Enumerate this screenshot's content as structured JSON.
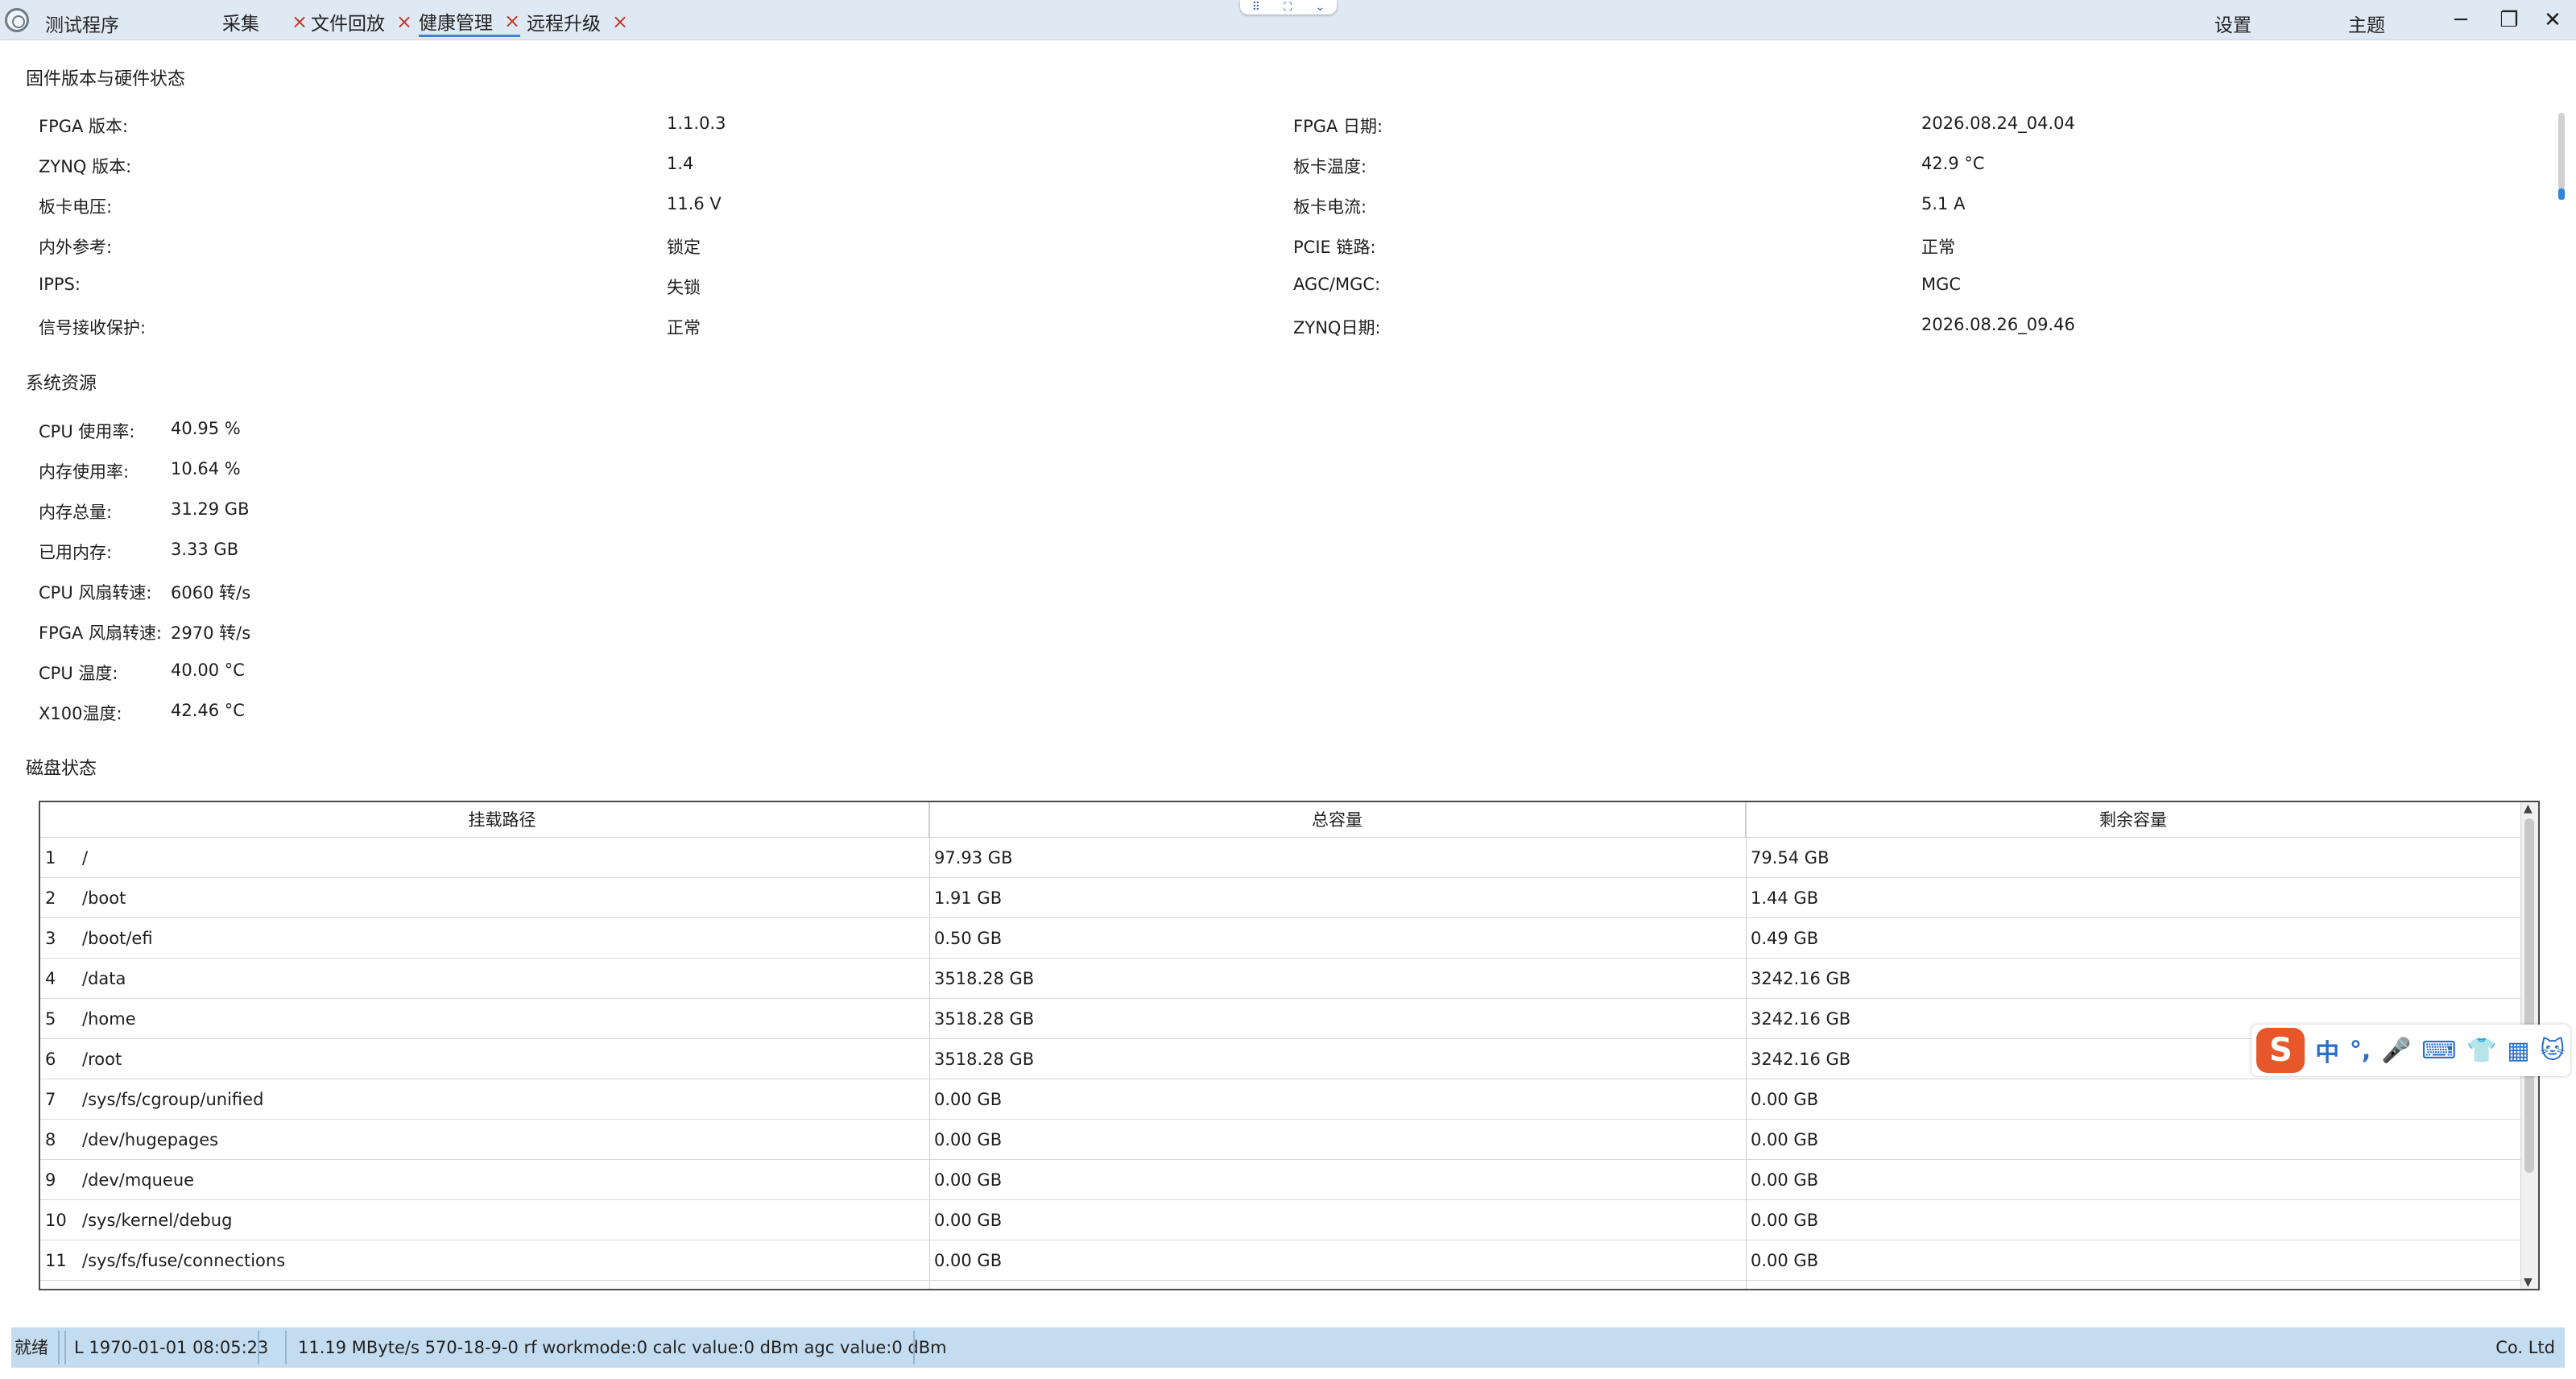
{
  "app": {
    "title": "测试程序"
  },
  "tabs": [
    {
      "label": "采集",
      "close": "×"
    },
    {
      "label": "文件回放",
      "close": "×"
    },
    {
      "label": "健康管理",
      "close": "×",
      "active": true
    },
    {
      "label": "远程升级",
      "close": "×"
    }
  ],
  "menu": {
    "settings": "设置",
    "theme": "主题"
  },
  "window_controls": {
    "minimize": "─",
    "maximize": "❐",
    "close": "✕"
  },
  "firmware": {
    "title": "固件版本与硬件状态",
    "items": [
      {
        "label": "FPGA 版本:",
        "value": "1.1.0.3"
      },
      {
        "label": "FPGA 日期:",
        "value": "2026.08.24_04.04"
      },
      {
        "label": "ZYNQ 版本:",
        "value": "1.4"
      },
      {
        "label": "板卡温度:",
        "value": "42.9 °C"
      },
      {
        "label": "板卡电压:",
        "value": "11.6 V"
      },
      {
        "label": "板卡电流:",
        "value": "5.1 A"
      },
      {
        "label": "内外参考:",
        "value": "锁定"
      },
      {
        "label": "PCIE 链路:",
        "value": "正常"
      },
      {
        "label": "IPPS:",
        "value": "失锁"
      },
      {
        "label": "AGC/MGC:",
        "value": "MGC"
      },
      {
        "label": "信号接收保护:",
        "value": "正常"
      },
      {
        "label": "ZYNQ日期:",
        "value": "2026.08.26_09.46"
      }
    ]
  },
  "resources": {
    "title": "系统资源",
    "items": [
      {
        "label": "CPU 使用率:",
        "value": "40.95 %"
      },
      {
        "label": "内存使用率:",
        "value": "10.64 %"
      },
      {
        "label": "内存总量:",
        "value": "31.29 GB"
      },
      {
        "label": "已用内存:",
        "value": "3.33 GB"
      },
      {
        "label": "CPU  风扇转速:",
        "value": "6060 转/s"
      },
      {
        "label": "FPGA 风扇转速:",
        "value": "2970 转/s"
      },
      {
        "label": "CPU 温度:",
        "value": "40.00 °C"
      },
      {
        "label": "X100温度:",
        "value": "42.46 °C"
      }
    ]
  },
  "disk": {
    "title": "磁盘状态",
    "columns": [
      "挂载路径",
      "总容量",
      "剩余容量"
    ],
    "rows": [
      {
        "index": "1",
        "path": "/",
        "total": "97.93 GB",
        "free": "79.54 GB"
      },
      {
        "index": "2",
        "path": "/boot",
        "total": "1.91 GB",
        "free": "1.44 GB"
      },
      {
        "index": "3",
        "path": "/boot/efi",
        "total": "0.50 GB",
        "free": "0.49 GB"
      },
      {
        "index": "4",
        "path": "/data",
        "total": "3518.28 GB",
        "free": "3242.16 GB"
      },
      {
        "index": "5",
        "path": "/home",
        "total": "3518.28 GB",
        "free": "3242.16 GB"
      },
      {
        "index": "6",
        "path": "/root",
        "total": "3518.28 GB",
        "free": "3242.16 GB"
      },
      {
        "index": "7",
        "path": "/sys/fs/cgroup/unified",
        "total": "0.00 GB",
        "free": "0.00 GB"
      },
      {
        "index": "8",
        "path": "/dev/hugepages",
        "total": "0.00 GB",
        "free": "0.00 GB"
      },
      {
        "index": "9",
        "path": "/dev/mqueue",
        "total": "0.00 GB",
        "free": "0.00 GB"
      },
      {
        "index": "10",
        "path": "/sys/kernel/debug",
        "total": "0.00 GB",
        "free": "0.00 GB"
      },
      {
        "index": "11",
        "path": "/sys/fs/fuse/connections",
        "total": "0.00 GB",
        "free": "0.00 GB"
      }
    ]
  },
  "ime": {
    "logo": "S",
    "items": [
      "中",
      "°,",
      "🎤",
      "⌨",
      "👕",
      "▦",
      "🐱"
    ]
  },
  "status": {
    "state": "就绪",
    "time": "L 1970-01-01 08:05:23",
    "info": "11.19 MByte/s 570-18-9-0 rf workmode:0 calc value:0 dBm agc value:0 dBm",
    "company": "Co. Ltd"
  }
}
